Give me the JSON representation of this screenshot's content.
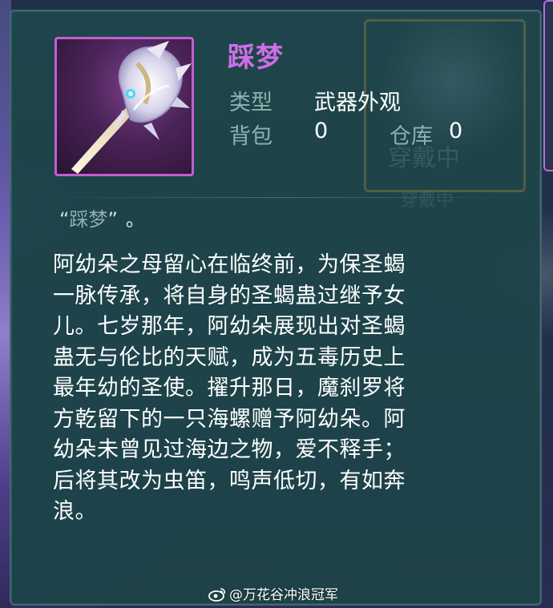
{
  "item": {
    "name": "踩梦",
    "type_label": "类型",
    "type_value": "武器外观",
    "bag_label": "背包",
    "bag_count": "0",
    "storage_label": "仓库",
    "storage_count": "0",
    "icon": "staff-weapon-icon"
  },
  "background": {
    "equip_button_text": "穿戴中",
    "faded_text": "穿戴中"
  },
  "quote": {
    "open": "“",
    "text": "踩梦",
    "close": "”",
    "end": "。"
  },
  "description": {
    "lines": [
      "阿幼朵之母留心在临终前，为保圣蝎",
      "一脉传承，将自身的圣蝎蛊过继予女",
      "儿。七岁那年，阿幼朵展现出对圣蝎",
      "蛊无与伦比的天赋，成为五毒历史上",
      "最年幼的圣使。擢升那日，魔刹罗将",
      "方乾留下的一只海螺赠予阿幼朵。阿",
      "幼朵未曾见过海边之物，爱不释手；",
      "后将其改为虫笛，鸣声低切，有如奔",
      "浪。"
    ]
  },
  "watermark": {
    "text": "@万花谷冲浪冠军",
    "icon": "weibo-icon"
  },
  "colors": {
    "item_name": "#cf6ee8",
    "label": "#8fb0ad",
    "value": "#ffffff",
    "panel_bg": "#1e464b",
    "icon_border": "#c25fce"
  }
}
